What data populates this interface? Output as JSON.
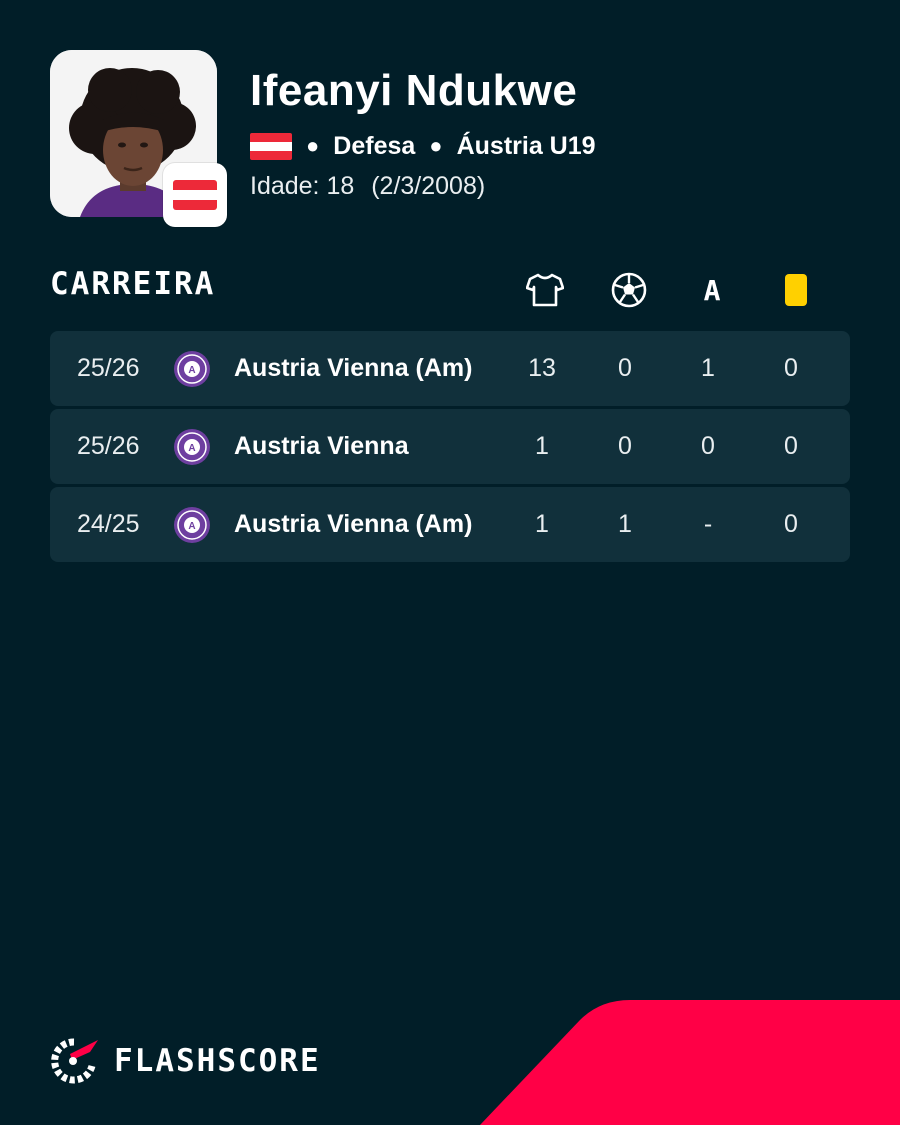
{
  "player": {
    "name": "Ifeanyi Ndukwe",
    "position": "Defesa",
    "team": "Áustria U19",
    "age_label": "Idade: 18",
    "birthdate": "(2/3/2008)",
    "nationality_flag": "austria-flag-icon"
  },
  "career": {
    "title": "CARREIRA",
    "columns": [
      {
        "icon": "shirt-icon",
        "meaning": "matches"
      },
      {
        "icon": "ball-icon",
        "meaning": "goals"
      },
      {
        "icon": "assist-icon",
        "label": "A"
      },
      {
        "icon": "yellow-card-icon",
        "meaning": "yellow cards"
      }
    ],
    "rows": [
      {
        "season": "25/26",
        "club": "Austria Vienna (Am)",
        "matches": "13",
        "goals": "0",
        "assists": "1",
        "yellow": "0"
      },
      {
        "season": "25/26",
        "club": "Austria Vienna",
        "matches": "1",
        "goals": "0",
        "assists": "0",
        "yellow": "0"
      },
      {
        "season": "24/25",
        "club": "Austria Vienna (Am)",
        "matches": "1",
        "goals": "1",
        "assists": "-",
        "yellow": "0"
      }
    ]
  },
  "footer": {
    "brand": "FLASHSCORE"
  },
  "colors": {
    "background": "#011e28",
    "row_background": "#11303b",
    "accent_red": "#ff0046",
    "yellow_card": "#ffd000",
    "club_purple": "#6e3fa0",
    "austria_red": "#ed2939"
  }
}
